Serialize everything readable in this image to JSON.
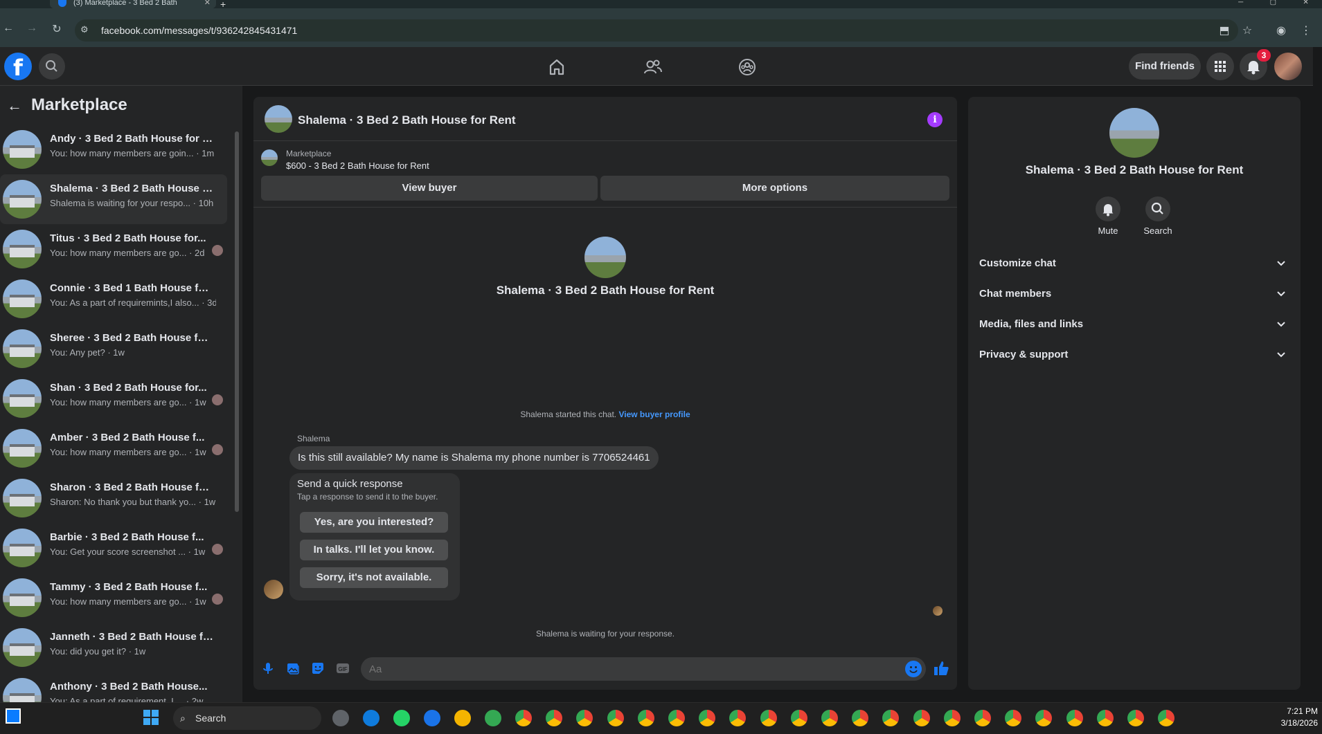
{
  "browser": {
    "tab_title": "(3) Marketplace - 3 Bed 2 Bath",
    "url": "facebook.com/messages/t/936242845431471"
  },
  "header": {
    "find_friends": "Find friends",
    "notification_count": "3",
    "brand_color": "#1877f2"
  },
  "sidebar": {
    "title": "Marketplace",
    "conversations": [
      {
        "name": "Andy · 3 Bed 2 Bath House for R...",
        "preview": "You: how many members are goin... · 1m",
        "has_mini_avatar": false,
        "active": false
      },
      {
        "name": "Shalema · 3 Bed 2 Bath House f...",
        "preview": "Shalema is waiting for your respo... · 10h",
        "has_mini_avatar": false,
        "active": true
      },
      {
        "name": "Titus · 3 Bed 2 Bath House for...",
        "preview": "You: how many members are go... · 2d",
        "has_mini_avatar": true,
        "active": false
      },
      {
        "name": "Connie · 3 Bed 1 Bath House for ...",
        "preview": "You: As a part of requiremints,I also... · 3d",
        "has_mini_avatar": false,
        "active": false
      },
      {
        "name": "Sheree · 3 Bed 2 Bath House for ...",
        "preview": "You: Any pet? · 1w",
        "has_mini_avatar": false,
        "active": false
      },
      {
        "name": "Shan · 3 Bed 2 Bath House for...",
        "preview": "You: how many members are go... · 1w",
        "has_mini_avatar": true,
        "active": false
      },
      {
        "name": "Amber · 3 Bed 2 Bath House f...",
        "preview": "You: how many members are go... · 1w",
        "has_mini_avatar": true,
        "active": false
      },
      {
        "name": "Sharon · 3 Bed 2 Bath House for...",
        "preview": "Sharon: No thank you but thank yo... · 1w",
        "has_mini_avatar": false,
        "active": false
      },
      {
        "name": "Barbie · 3 Bed 2 Bath House f...",
        "preview": "You: Get your score screenshot ... · 1w",
        "has_mini_avatar": true,
        "active": false
      },
      {
        "name": "Tammy · 3 Bed 2 Bath House f...",
        "preview": "You: how many members are go... · 1w",
        "has_mini_avatar": true,
        "active": false
      },
      {
        "name": "Janneth · 3 Bed 2 Bath House fo...",
        "preview": "You: did you get it? · 1w",
        "has_mini_avatar": false,
        "active": false
      },
      {
        "name": "Anthony · 3 Bed 2 Bath House...",
        "preview": "You: As a part of requirement, I ... · 2w",
        "has_mini_avatar": false,
        "active": false
      }
    ]
  },
  "chat": {
    "title": "Shalema · 3 Bed 2 Bath House for Rent",
    "marketplace_label": "Marketplace",
    "listing": "$600 - 3 Bed 2 Bath House for Rent",
    "view_buyer": "View buyer",
    "more_options": "More options",
    "center_name": "Shalema · 3 Bed 2 Bath House for Rent",
    "started_text": "Shalema started this chat.",
    "view_buyer_profile": "View buyer profile",
    "sender": "Shalema",
    "message": "Is this still available? My name is Shalema my phone number is 7706524461",
    "quick_response_title": "Send a quick response",
    "quick_response_sub": "Tap a response to send it to the buyer.",
    "quick_responses": [
      "Yes, are you interested?",
      "In talks. I'll let you know.",
      "Sorry, it's not available."
    ],
    "waiting_text": "Shalema is waiting for your response.",
    "composer_placeholder": "Aa",
    "accent_color": "#a43bff"
  },
  "right_panel": {
    "name": "Shalema · 3 Bed 2 Bath House for Rent",
    "mute": "Mute",
    "search": "Search",
    "sections": [
      "Customize chat",
      "Chat members",
      "Media, files and links",
      "Privacy & support"
    ]
  },
  "taskbar": {
    "search": "Search",
    "time": "7:21 PM",
    "date": "3/18/2026"
  }
}
